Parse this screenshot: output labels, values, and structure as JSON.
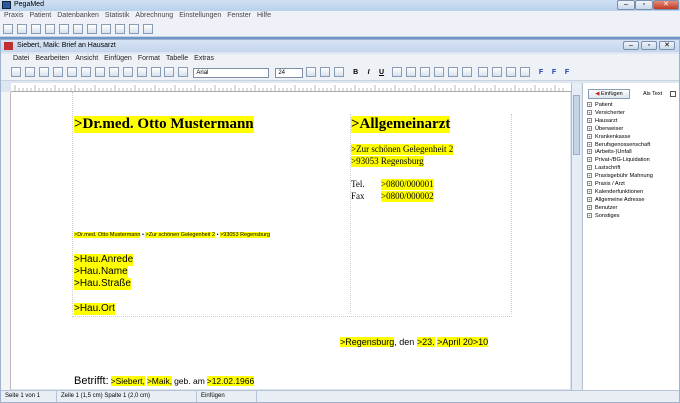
{
  "app": {
    "title": "PegaMed",
    "menu": [
      "Praxis",
      "Patient",
      "Datenbanken",
      "Statistik",
      "Abrechnung",
      "Einstellungen",
      "Fenster",
      "Hilfe"
    ]
  },
  "doc": {
    "title": "Siebert, Maik: Brief an Hausarzt",
    "menu": [
      "Datei",
      "Bearbeiten",
      "Ansicht",
      "Einfügen",
      "Format",
      "Tabelle",
      "Extras"
    ],
    "font": "Arial",
    "size": "24",
    "bold": "B",
    "italic": "I",
    "underline": "U",
    "field_btns": [
      "F",
      "F",
      "F"
    ]
  },
  "letter": {
    "sender": ">Dr.med. Otto Mustermann",
    "specialty": ">Allgemeinarzt",
    "street": ">Zur schönen Gelegenheit 2",
    "city": ">93053 Regensburg",
    "tel_label": "Tel.",
    "tel": ">0800/000001",
    "fax_label": "Fax",
    "fax": ">0800/000002",
    "return_addr": [
      ">Dr.med. Otto Mustermann",
      "•",
      ">Zur schönen Gelegenheit 2",
      "•",
      ">93053 Regensburg"
    ],
    "recipient": [
      ">Hau.Anrede",
      ">Hau.Name",
      ">Hau.Straße"
    ],
    "recipient_city": ">Hau.Ort",
    "date": {
      "city": ">Regensburg",
      "sep": ", den",
      "day": ">23.",
      "month": ">April 20",
      "year": ">10"
    },
    "subject_label": "Betrifft:",
    "subject": {
      "last": ">Siebert,",
      "first": ">Maik,",
      "born": "geb. am",
      "dob": ">12.02.1966"
    }
  },
  "panel": {
    "insert_btn": "Einfügen",
    "as_text": "Als Text",
    "items": [
      "Patient",
      "Versicherter",
      "Hausarzt",
      "Überweiser",
      "Krankenkasse",
      "Berufsgenossenschaft",
      "iArbeits-)Unfall",
      "Privat-/BG-Liquidation",
      "Lastschrift",
      "Praxisgebühr Mahnung",
      "Praxis / Arzt",
      "Kalenderfunktionen",
      "Allgemeine Adresse",
      "Benutzer",
      "Sonstiges"
    ]
  },
  "status": [
    "Seite 1 von 1",
    "Zeile 1 (1,5 cm)  Spalte 1 (2,0 cm)",
    "Einfügen"
  ],
  "colors": {
    "highlight": "#ffff00",
    "desktop": "#6d95c6"
  }
}
